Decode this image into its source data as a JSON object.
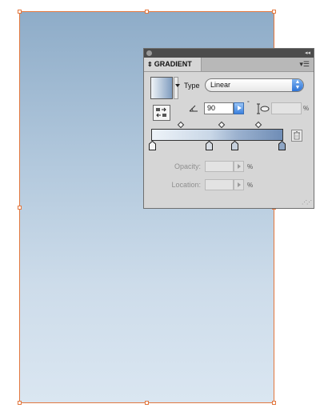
{
  "panel": {
    "title": "GRADIENT",
    "tab_arrows": "⇕",
    "collapse_glyph": "◂◂",
    "menu_glyph": "▾☰",
    "type_label": "Type",
    "type_value": "Linear",
    "angle_value": "90",
    "degree_symbol": "°",
    "aspect_pct_symbol": "%",
    "opacity_label": "Opacity:",
    "opacity_pct": "%",
    "location_label": "Location:",
    "location_pct": "%"
  },
  "gradient": {
    "start_color": "#eef3f8",
    "end_color": "#6f8db6",
    "stop_positions_percent": [
      0,
      44,
      63,
      100
    ],
    "midpoint_positions_percent": [
      22,
      53,
      81
    ]
  },
  "icons": {
    "close": "close-icon",
    "collapse": "collapse-icon",
    "panel_menu": "menu-icon",
    "reverse": "reverse-gradient-icon",
    "angle": "angle-icon",
    "aspect": "aspect-ratio-icon",
    "delete": "trash-icon"
  },
  "colors": {
    "selection_accent": "#e2773e",
    "panel_bg": "#d6d6d6"
  }
}
